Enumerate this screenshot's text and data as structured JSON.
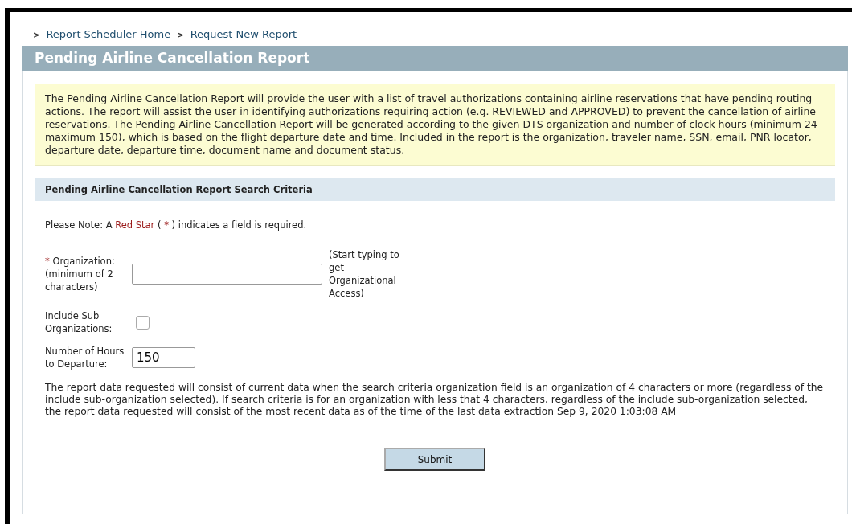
{
  "breadcrumbs": [
    {
      "marker": ">",
      "label": "Report Scheduler Home"
    },
    {
      "marker": ">",
      "label": "Request New Report"
    }
  ],
  "title": "Pending Airline Cancellation Report",
  "description": "The Pending Airline Cancellation Report will provide the user with a list of travel authorizations containing airline reservations that have pending routing actions. The report will assist the user in identifying authorizations requiring action (e.g. REVIEWED and APPROVED) to prevent the cancellation of airline reservations. The Pending Airline Cancellation Report will be generated according to the given DTS organization and number of clock hours (minimum 24 maximum 150), which is based on the flight departure date and time. Included in the report is the organization, traveler name, SSN, email, PNR locator, departure date, departure time, document name and document status.",
  "section_title": "Pending Airline Cancellation Report Search Criteria",
  "note": [
    {
      "kind": "plain",
      "text": "Please Note:  A "
    },
    {
      "kind": "red",
      "text": "Red Star"
    },
    {
      "kind": "plain",
      "text": " ( "
    },
    {
      "kind": "red",
      "text": "*"
    },
    {
      "kind": "plain",
      "text": " ) indicates a field is required."
    }
  ],
  "fields": [
    {
      "kind": "text",
      "required_mark": "*",
      "label": "Organization: (minimum of 2 characters)",
      "hint": "(Start typing to get Organizational Access)"
    },
    {
      "kind": "checkbox",
      "label": "Include Sub Organizations:",
      "checked": false
    },
    {
      "kind": "number",
      "label": "Number of Hours to Departure:",
      "value": "150"
    }
  ],
  "info": "The report data requested will consist of current data when the search criteria organization field is an organization of 4 characters or more (regardless of the include sub-organization selected). If search criteria is for an organization with less that 4 characters, regardless of the include sub-organization selected, the report data requested will consist of the most recent data as of the time of the last data extraction Sep 9, 2020 1:03:08 AM",
  "submit": "Submit"
}
